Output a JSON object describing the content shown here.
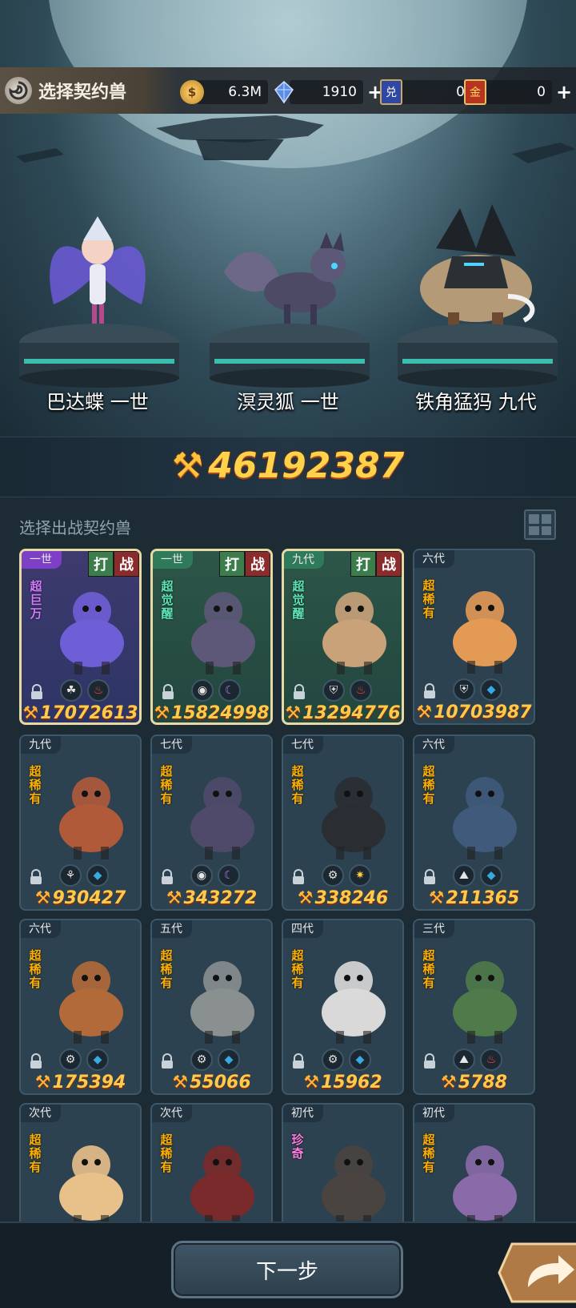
{
  "header": {
    "title": "选择契约兽",
    "gold": "6.3M",
    "crystal": "1910",
    "ticket_blue": "0",
    "ticket_gold": "0",
    "ticket_blue_glyph": "兑",
    "ticket_gold_glyph": "金"
  },
  "selected": [
    {
      "name": "巴达蝶 一世"
    },
    {
      "name": "溟灵狐 一世"
    },
    {
      "name": "铁角猛犸 九代"
    }
  ],
  "total_power": "46192387",
  "list": {
    "label": "选择出战契约兽",
    "badge_fight": "打",
    "badge_war": "战",
    "cards": [
      {
        "gen": "一世",
        "rarity": "超巨万",
        "power": "17072613",
        "selected": "purple"
      },
      {
        "gen": "一世",
        "rarity": "超觉醒",
        "power": "15824998",
        "selected": "green"
      },
      {
        "gen": "九代",
        "rarity": "超觉醒",
        "power": "13294776",
        "selected": "green"
      },
      {
        "gen": "六代",
        "rarity": "超稀有",
        "power": "10703987"
      },
      {
        "gen": "九代",
        "rarity": "超稀有",
        "power": "930427"
      },
      {
        "gen": "七代",
        "rarity": "超稀有",
        "power": "343272"
      },
      {
        "gen": "七代",
        "rarity": "超稀有",
        "power": "338246"
      },
      {
        "gen": "六代",
        "rarity": "超稀有",
        "power": "211365"
      },
      {
        "gen": "六代",
        "rarity": "超稀有",
        "power": "175394"
      },
      {
        "gen": "五代",
        "rarity": "超稀有",
        "power": "55066"
      },
      {
        "gen": "四代",
        "rarity": "超稀有",
        "power": "15962"
      },
      {
        "gen": "三代",
        "rarity": "超稀有",
        "power": "5788"
      },
      {
        "gen": "次代",
        "rarity": "超稀有",
        "power": ""
      },
      {
        "gen": "次代",
        "rarity": "超稀有",
        "power": ""
      },
      {
        "gen": "初代",
        "rarity": "珍奇",
        "power": ""
      },
      {
        "gen": "初代",
        "rarity": "超稀有",
        "power": ""
      }
    ]
  },
  "footer": {
    "next": "下一步"
  },
  "colors": {
    "accent_gold": "#ffc94a",
    "card_bg": "#2c4250"
  }
}
